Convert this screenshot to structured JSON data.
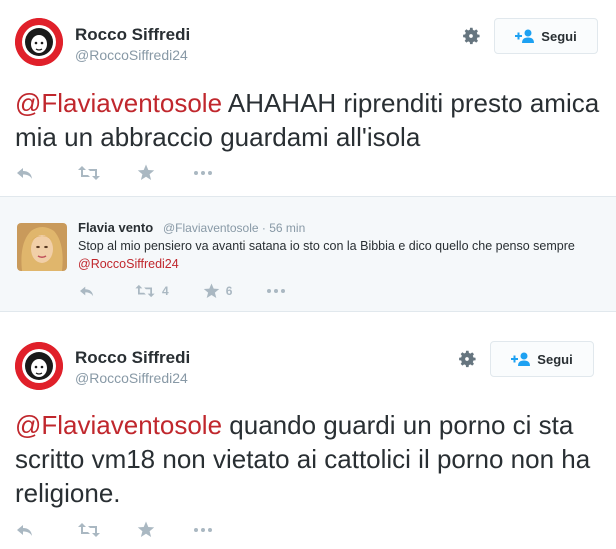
{
  "tweets": [
    {
      "name": "Rocco Siffredi",
      "handle": "@RoccoSiffredi24",
      "follow_label": "Segui",
      "mention": "@Flaviaventosole",
      "text": " AHAHAH riprenditi presto amica mia un abbraccio guardami all'isola"
    },
    {
      "name": "Rocco Siffredi",
      "handle": "@RoccoSiffredi24",
      "follow_label": "Segui",
      "mention": "@Flaviaventosole",
      "text": " quando guardi un porno ci sta scritto vm18 non vietato ai cattolici il porno non ha religione."
    }
  ],
  "quoted": {
    "name": "Flavia vento",
    "handle": "@Flaviaventosole",
    "time": "· 56 min",
    "text": "Stop al mio pensiero va avanti satana io sto con la Bibbia e dico quello che penso sempre ",
    "mention": "@RoccoSiffredi24",
    "retweets": "4",
    "favorites": "6"
  },
  "icons": {
    "reply": "reply-icon",
    "retweet": "retweet-icon",
    "favorite": "star-icon",
    "more": "more-icon",
    "gear": "gear-icon",
    "follow": "add-user-icon"
  },
  "colors": {
    "mention": "#c0272d",
    "icon": "#aab8c2",
    "handle": "#8899a6",
    "quote_bg": "#f5f8fa"
  }
}
